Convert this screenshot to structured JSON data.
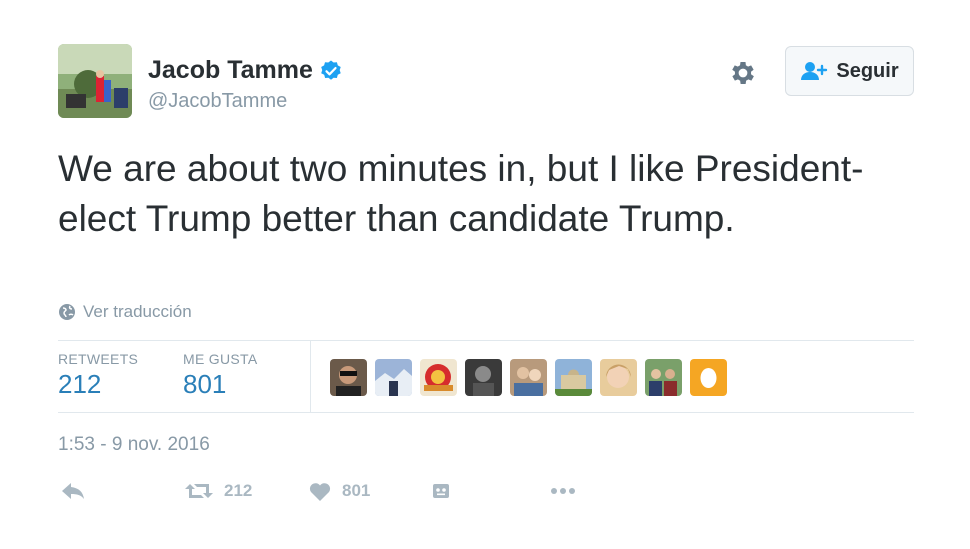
{
  "user": {
    "name": "Jacob Tamme",
    "handle": "@JacobTamme",
    "verified": true
  },
  "header": {
    "follow_label": "Seguir",
    "settings_icon": "gear-icon",
    "follow_icon": "add-user-icon"
  },
  "tweet": {
    "text": "We are about two minutes in, but I like President-elect Trump better than candidate Trump.",
    "translate_label": "Ver traducción",
    "timestamp": "1:53 - 9 nov. 2016"
  },
  "stats": {
    "retweets_label": "RETWEETS",
    "retweets_count": "212",
    "likes_label": "ME GUSTA",
    "likes_count": "801"
  },
  "actions": {
    "retweet_count": "212",
    "like_count": "801"
  },
  "colors": {
    "accent": "#1da1f2",
    "muted": "#8899a6",
    "icon": "#aab8c2",
    "text": "#292f33"
  }
}
